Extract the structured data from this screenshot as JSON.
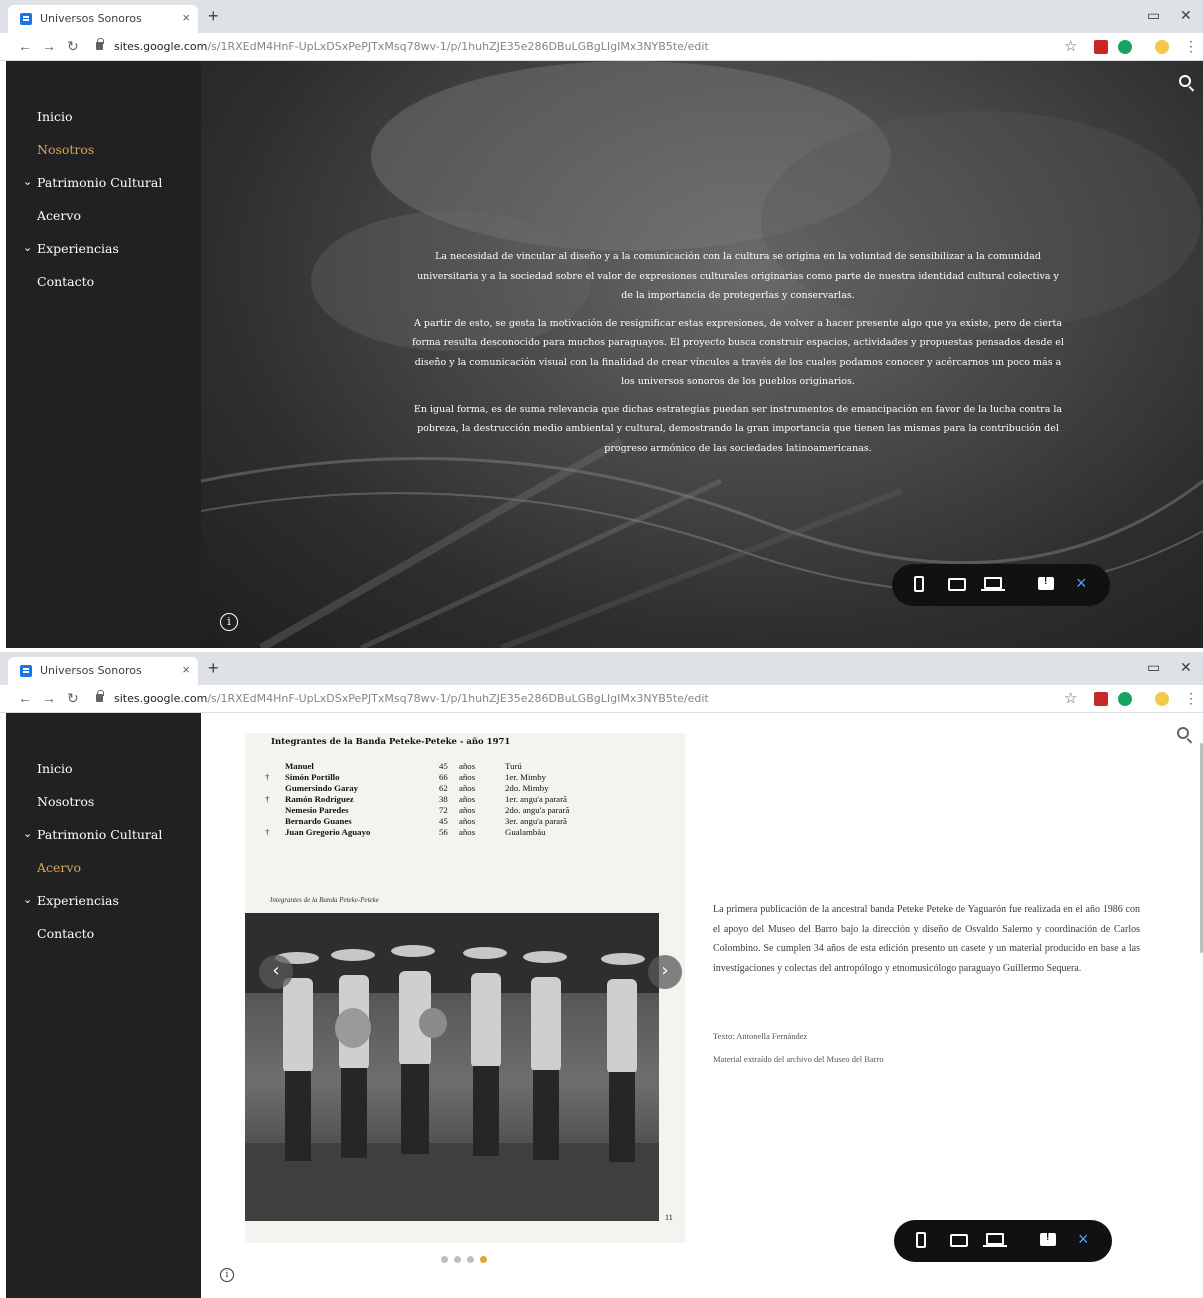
{
  "browser": {
    "tab_title": "Universos Sonoros",
    "tab_close": "×",
    "new_tab": "+",
    "url_domain": "sites.google.com",
    "url_path_1": "/s/1RXEdM4HnF-UpLxDSxPePJTxMsq78wv-1/p/1huhZJE35e286DBuLGBgLIgIMx3NYB5te/edit",
    "url_path_2": "/s/1RXEdM4HnF-UpLxDSxPePJTxMsq78wv-1/p/1huhZJE35e286DBuLGBgLIgIMx3NYB5te/edit"
  },
  "sidebar": {
    "items": [
      {
        "label": "Inicio"
      },
      {
        "label": "Nosotros"
      },
      {
        "label": "Patrimonio Cultural"
      },
      {
        "label": "Acervo"
      },
      {
        "label": "Experiencias"
      },
      {
        "label": "Contacto"
      }
    ],
    "active_first": "Nosotros",
    "active_second": "Acervo"
  },
  "hero": {
    "paragraphs": [
      "La necesidad de vincular al diseño y a la comunicación con la cultura se origina en la voluntad de sensibilizar a la comunidad universitaria y a la sociedad sobre el valor de expresiones culturales originarias como parte de nuestra identidad cultural colectiva y de la importancia de protegerlas y conservarlas.",
      "A partir de esto, se gesta la motivación de resignificar estas expresiones, de volver a hacer presente algo que ya existe, pero de cierta forma resulta desconocido para muchos paraguayos. El proyecto busca construir espacios, actividades y propuestas pensados desde el diseño y la comunicación visual con la finalidad de crear vínculos a través de los cuales podamos conocer y acércarnos un poco más a los universos sonoros de los pueblos originarios.",
      "En igual forma, es de suma relevancia que dichas estrategias puedan ser instrumentos de emancipación en favor de la lucha contra la pobreza, la destrucción medio ambiental y cultural, demostrando la gran importancia que tienen las mismas para la contribución del progreso armónico de las sociedades latinoamericanas."
    ]
  },
  "document": {
    "heading": "Integrantes de la Banda Peteke-Peteke - año 1971",
    "rows": [
      {
        "mark": "",
        "name": "Manuel",
        "age": "45",
        "unit": "años",
        "role": "Turú"
      },
      {
        "mark": "†",
        "name": "Simón Portillo",
        "age": "66",
        "unit": "años",
        "role": "1er. Mimby"
      },
      {
        "mark": "",
        "name": "Gumersindo Garay",
        "age": "62",
        "unit": "años",
        "role": "2do. Mimby"
      },
      {
        "mark": "†",
        "name": "Ramón Rodríguez",
        "age": "38",
        "unit": "años",
        "role": "1er. angu'a pararã"
      },
      {
        "mark": "",
        "name": "Nemesio Paredes",
        "age": "72",
        "unit": "años",
        "role": "2do. angu'a pararã"
      },
      {
        "mark": "",
        "name": "Bernardo Guanes",
        "age": "45",
        "unit": "años",
        "role": "3er. angu'a pararã"
      },
      {
        "mark": "†",
        "name": "Juan Gregorio Aguayo",
        "age": "56",
        "unit": "años",
        "role": "Gualambáu"
      }
    ],
    "caption": "Integrantes de la Banda Peteke-Peteke",
    "page_number": "11"
  },
  "carousel": {
    "prev": "‹",
    "next": "›",
    "slide_count": 4,
    "active_index": 3
  },
  "description": {
    "text": "La primera publicación de la ancestral banda Peteke Peteke de Yaguarón fue realizada en el año 1986 con el apoyo del Museo del Barro bajo la dirección y diseño de Osvaldo Salerno y coordinación de Carlos Colombino. Se cumplen 34 años de esta edición presento un casete y un material producido en base a las investigaciones y colectas del antropólogo y etnomusicólogo paraguayo Guillermo Sequera.",
    "credit_1": "Texto: Antonella Fernández",
    "credit_2": "Material extraído del archivo del Museo del Barro"
  },
  "preview_toolbar": {
    "close": "×"
  },
  "icons": {
    "info": "i",
    "star": "☆",
    "menu": "⋮"
  },
  "colors": {
    "sidebar_bg": "#212121",
    "active_nav": "#d8a657",
    "dot_active": "#e0a43a",
    "preview_close": "#4ea1ff"
  }
}
